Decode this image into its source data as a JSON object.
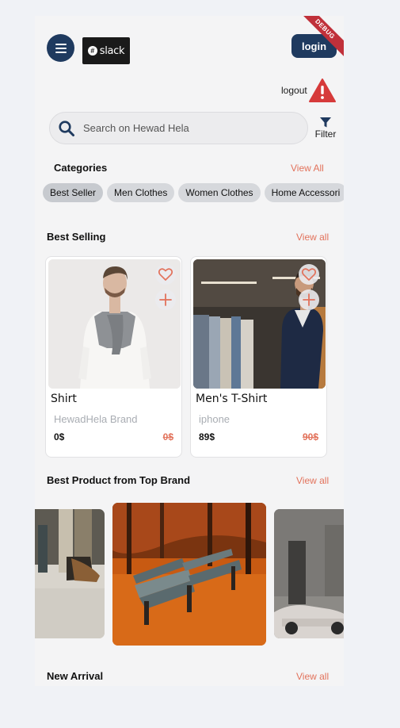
{
  "header": {
    "logo_text": "slack",
    "login_label": "login",
    "debug_banner": "DEBUG",
    "logout_label": "logout"
  },
  "search": {
    "placeholder": "Search on Hewad Hela",
    "value": ""
  },
  "filter": {
    "label": "Filter"
  },
  "categories": {
    "title": "Categories",
    "view_all": "View All",
    "items": [
      "Best Seller",
      "Men Clothes",
      "Women Clothes",
      "Home Accessori"
    ]
  },
  "best_selling": {
    "title": "Best Selling",
    "view_all": "View all",
    "products": [
      {
        "name": "Shirt",
        "brand": "HewadHela Brand",
        "price": "0$",
        "old_price": "0$"
      },
      {
        "name": "Men's T-Shirt",
        "brand": "iphone",
        "price": "89$",
        "old_price": "90$"
      }
    ]
  },
  "top_brand": {
    "title": "Best Product from Top Brand",
    "view_all": "View all"
  },
  "new_arrival": {
    "title": "New Arrival",
    "view_all": "View all"
  },
  "colors": {
    "primary": "#1f3a5f",
    "accent": "#e2725b",
    "warning": "#d63a3a",
    "background": "#f4f4f5"
  },
  "icons": [
    "menu-icon",
    "search-icon",
    "filter-icon",
    "warning-icon",
    "heart-icon",
    "plus-icon"
  ]
}
